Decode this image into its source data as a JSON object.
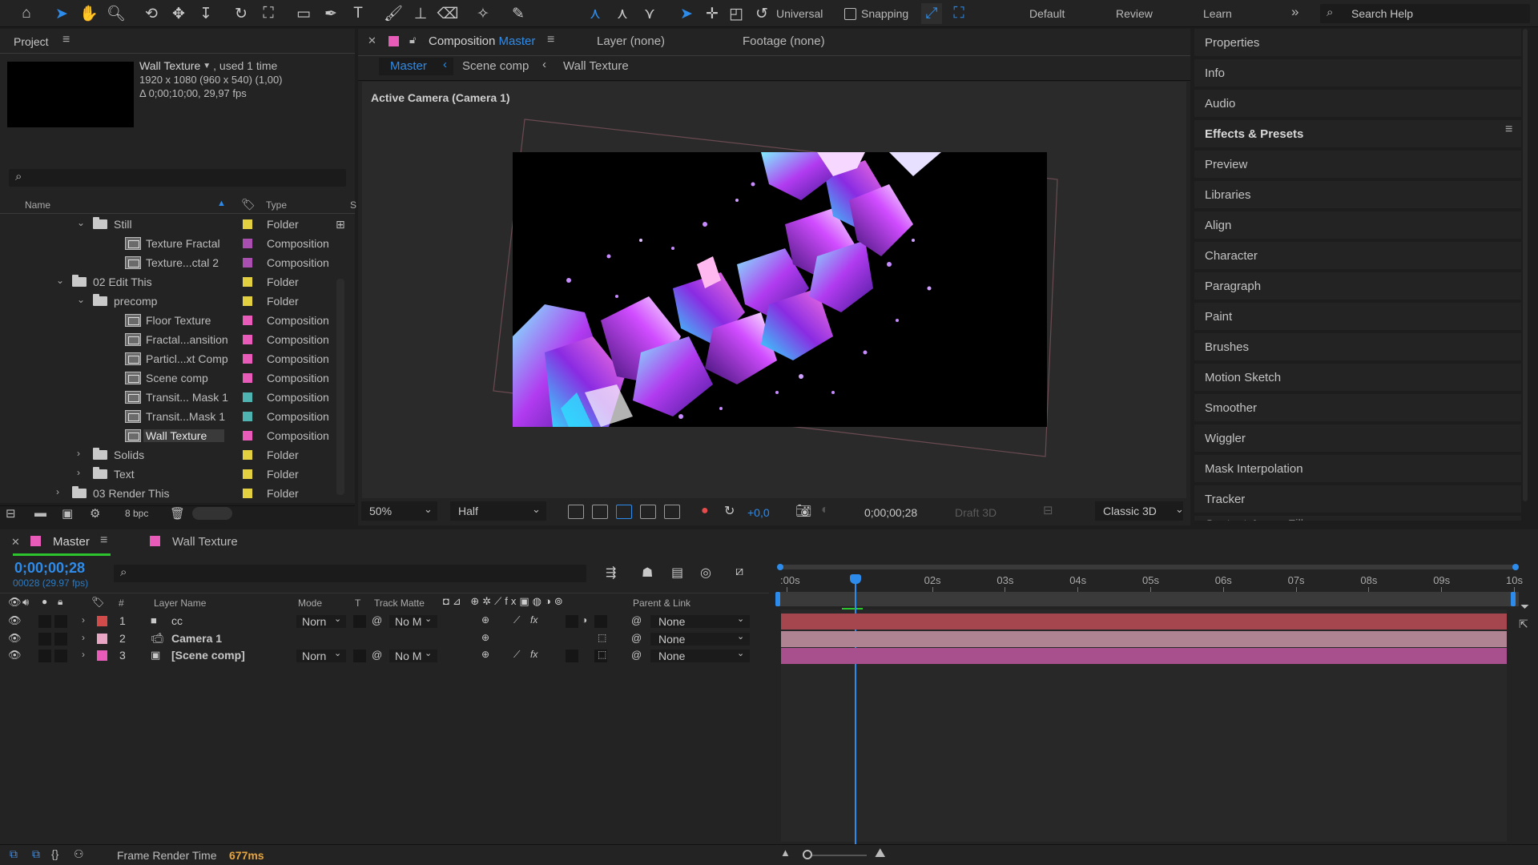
{
  "toolbar": {
    "universal_label": "Universal",
    "snapping_label": "Snapping",
    "workspaces": [
      "Default",
      "Review",
      "Learn"
    ],
    "more": "»",
    "search_help": "Search Help"
  },
  "project": {
    "title": "Project",
    "selected_name": "Wall Texture",
    "used": ", used 1 time",
    "dims": "1920 x 1080  (960 x 540) (1,00)",
    "duration": "Δ 0;00;10;00, 29,97 fps",
    "col_name": "Name",
    "col_type": "Type",
    "col_extra": "S",
    "rows": [
      {
        "name": "Still",
        "type": "Folder",
        "kind": "folder",
        "indent": 1,
        "twirl": "⌄",
        "color": "#e3d041"
      },
      {
        "name": "Texture Fractal",
        "type": "Composition",
        "kind": "comp",
        "indent": 2,
        "twirl": "",
        "color": "#a84fb0"
      },
      {
        "name": "Texture...ctal 2",
        "type": "Composition",
        "kind": "comp",
        "indent": 2,
        "twirl": "",
        "color": "#a84fb0"
      },
      {
        "name": "02 Edit This",
        "type": "Folder",
        "kind": "folder",
        "indent": 0,
        "twirl": "⌄",
        "color": "#e3d041"
      },
      {
        "name": "precomp",
        "type": "Folder",
        "kind": "folder",
        "indent": 1,
        "twirl": "⌄",
        "color": "#e3d041"
      },
      {
        "name": "Floor Texture",
        "type": "Composition",
        "kind": "comp",
        "indent": 2,
        "twirl": "",
        "color": "#e85bb8"
      },
      {
        "name": "Fractal...ansition",
        "type": "Composition",
        "kind": "comp",
        "indent": 2,
        "twirl": "",
        "color": "#e85bb8"
      },
      {
        "name": "Particl...xt Comp",
        "type": "Composition",
        "kind": "comp",
        "indent": 2,
        "twirl": "",
        "color": "#e85bb8"
      },
      {
        "name": "Scene comp",
        "type": "Composition",
        "kind": "comp",
        "indent": 2,
        "twirl": "",
        "color": "#e85bb8"
      },
      {
        "name": "Transit... Mask 1",
        "type": "Composition",
        "kind": "comp",
        "indent": 2,
        "twirl": "",
        "color": "#4fb3b1"
      },
      {
        "name": "Transit...Mask 1",
        "type": "Composition",
        "kind": "comp",
        "indent": 2,
        "twirl": "",
        "color": "#4fb3b1"
      },
      {
        "name": "Wall Texture",
        "type": "Composition",
        "kind": "comp",
        "indent": 2,
        "twirl": "",
        "color": "#e85bb8",
        "selected": true
      },
      {
        "name": "Solids",
        "type": "Folder",
        "kind": "folder",
        "indent": 1,
        "twirl": "›",
        "color": "#e3d041"
      },
      {
        "name": "Text",
        "type": "Folder",
        "kind": "folder",
        "indent": 1,
        "twirl": "›",
        "color": "#e3d041"
      },
      {
        "name": "03 Render This",
        "type": "Folder",
        "kind": "folder",
        "indent": 0,
        "twirl": "›",
        "color": "#e3d041"
      }
    ],
    "bpc": "8 bpc"
  },
  "viewer": {
    "tab_comp": "Composition",
    "tab_comp_name": "Master",
    "tab_layer": "Layer (none)",
    "tab_footage": "Footage (none)",
    "crumbs": [
      "Master",
      "Scene comp",
      "Wall Texture"
    ],
    "camera": "Active Camera (Camera 1)",
    "zoom": "50%",
    "resolution": "Half",
    "exposure": "+0,0",
    "timecode": "0;00;00;28",
    "draft": "Draft 3D",
    "renderer": "Classic 3D"
  },
  "right_panel": {
    "items": [
      "Properties",
      "Info",
      "Audio",
      "Effects & Presets",
      "Preview",
      "Libraries",
      "Align",
      "Character",
      "Paragraph",
      "Paint",
      "Brushes",
      "Motion Sketch",
      "Smoother",
      "Wiggler",
      "Mask Interpolation",
      "Tracker",
      "Content-Aware Fill"
    ],
    "selected": "Effects & Presets"
  },
  "timeline": {
    "tab_master": "Master",
    "tab_wall": "Wall Texture",
    "timecode": "0;00;00;28",
    "frame_info": "00028 (29.97 fps)",
    "col_layer_name": "Layer Name",
    "col_mode": "Mode",
    "col_t": "T",
    "col_track_matte": "Track Matte",
    "col_parent": "Parent & Link",
    "col_num": "#",
    "ruler": [
      ":00s",
      "02s",
      "03s",
      "04s",
      "05s",
      "06s",
      "07s",
      "08s",
      "09s",
      "10s"
    ],
    "playhead_fraction": 0.0933,
    "layers": [
      {
        "num": "1",
        "name": "cc",
        "mode": "Norn",
        "matte": "No M",
        "parent": "None",
        "label": "#d24b4b",
        "bar": "#a5454d",
        "icon": "solid"
      },
      {
        "num": "2",
        "name": "Camera 1",
        "mode": "",
        "matte": "",
        "parent": "None",
        "label": "#e8a6c4",
        "bar": "#b08393",
        "icon": "camera"
      },
      {
        "num": "3",
        "name": "[Scene comp]",
        "mode": "Norn",
        "matte": "No M",
        "parent": "None",
        "label": "#e85bb8",
        "bar": "#a8508e",
        "icon": "comp"
      }
    ]
  },
  "status": {
    "label": "Frame Render Time",
    "value": "677ms",
    "value_color": "#e6a43c"
  }
}
